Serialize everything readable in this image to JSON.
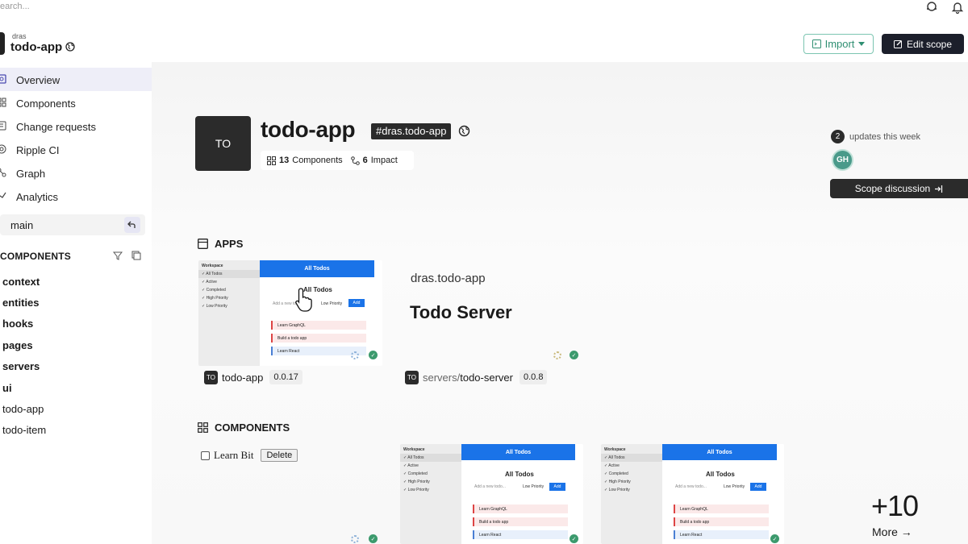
{
  "topbar": {
    "search_placeholder": "earch..."
  },
  "scope": {
    "owner": "dras",
    "name": "todo-app"
  },
  "actions": {
    "import_label": "Import",
    "edit_scope_label": "Edit scope"
  },
  "sidebar": {
    "items": [
      {
        "label": "Overview",
        "icon": "overview-icon"
      },
      {
        "label": "Components",
        "icon": "components-icon"
      },
      {
        "label": "Change requests",
        "icon": "change-requests-icon"
      },
      {
        "label": "Ripple CI",
        "icon": "ripple-ci-icon"
      },
      {
        "label": "Graph",
        "icon": "graph-icon"
      },
      {
        "label": "Analytics",
        "icon": "analytics-icon"
      }
    ],
    "branch": "main",
    "components_heading": "COMPONENTS",
    "components": [
      {
        "label": "context",
        "bold": true
      },
      {
        "label": "entities",
        "bold": true
      },
      {
        "label": "hooks",
        "bold": true
      },
      {
        "label": "pages",
        "bold": true
      },
      {
        "label": "servers",
        "bold": true
      },
      {
        "label": "ui",
        "bold": true
      },
      {
        "label": "todo-app",
        "bold": false
      },
      {
        "label": "todo-item",
        "bold": false
      }
    ]
  },
  "header": {
    "tile": "TO",
    "title": "todo-app",
    "tag": "#dras.todo-app",
    "components_count": "13",
    "components_label": "Components",
    "impact_count": "6",
    "impact_label": "Impact",
    "updates_count": "2",
    "updates_label": "updates this week",
    "user_initials": "GH",
    "scope_discussion": "Scope discussion"
  },
  "apps": {
    "heading": "APPS",
    "preview": {
      "sidebar_title": "Workspace",
      "sidebar_items": [
        "✓ All Todos",
        "✓ Active",
        "✓ Completed",
        "✓ High Priority",
        "✓ Low Priority"
      ],
      "bar": "All Todos",
      "heading": "All Todos",
      "input": "Add a new todo...",
      "priority": "Low Priority",
      "add": "Add",
      "todos": [
        "Learn GraphQL",
        "Build a todo app",
        "Learn React"
      ]
    },
    "app1": {
      "badge": "TO",
      "name": "todo-app",
      "version": "0.0.17"
    },
    "app2": {
      "badge": "TO",
      "id": "dras.todo-app",
      "title": "Todo Server",
      "path_prefix": "servers/",
      "path_name": "todo-server",
      "version": "0.0.8"
    }
  },
  "components_section": {
    "heading": "COMPONENTS",
    "bit_label": "Learn Bit",
    "delete_label": "Delete",
    "more_count": "+10",
    "more_label": "More →"
  },
  "colors": {
    "accent": "#1a73e8",
    "success": "#3c9a6d",
    "dark": "#2b2b2b",
    "import": "#2f8f72"
  }
}
